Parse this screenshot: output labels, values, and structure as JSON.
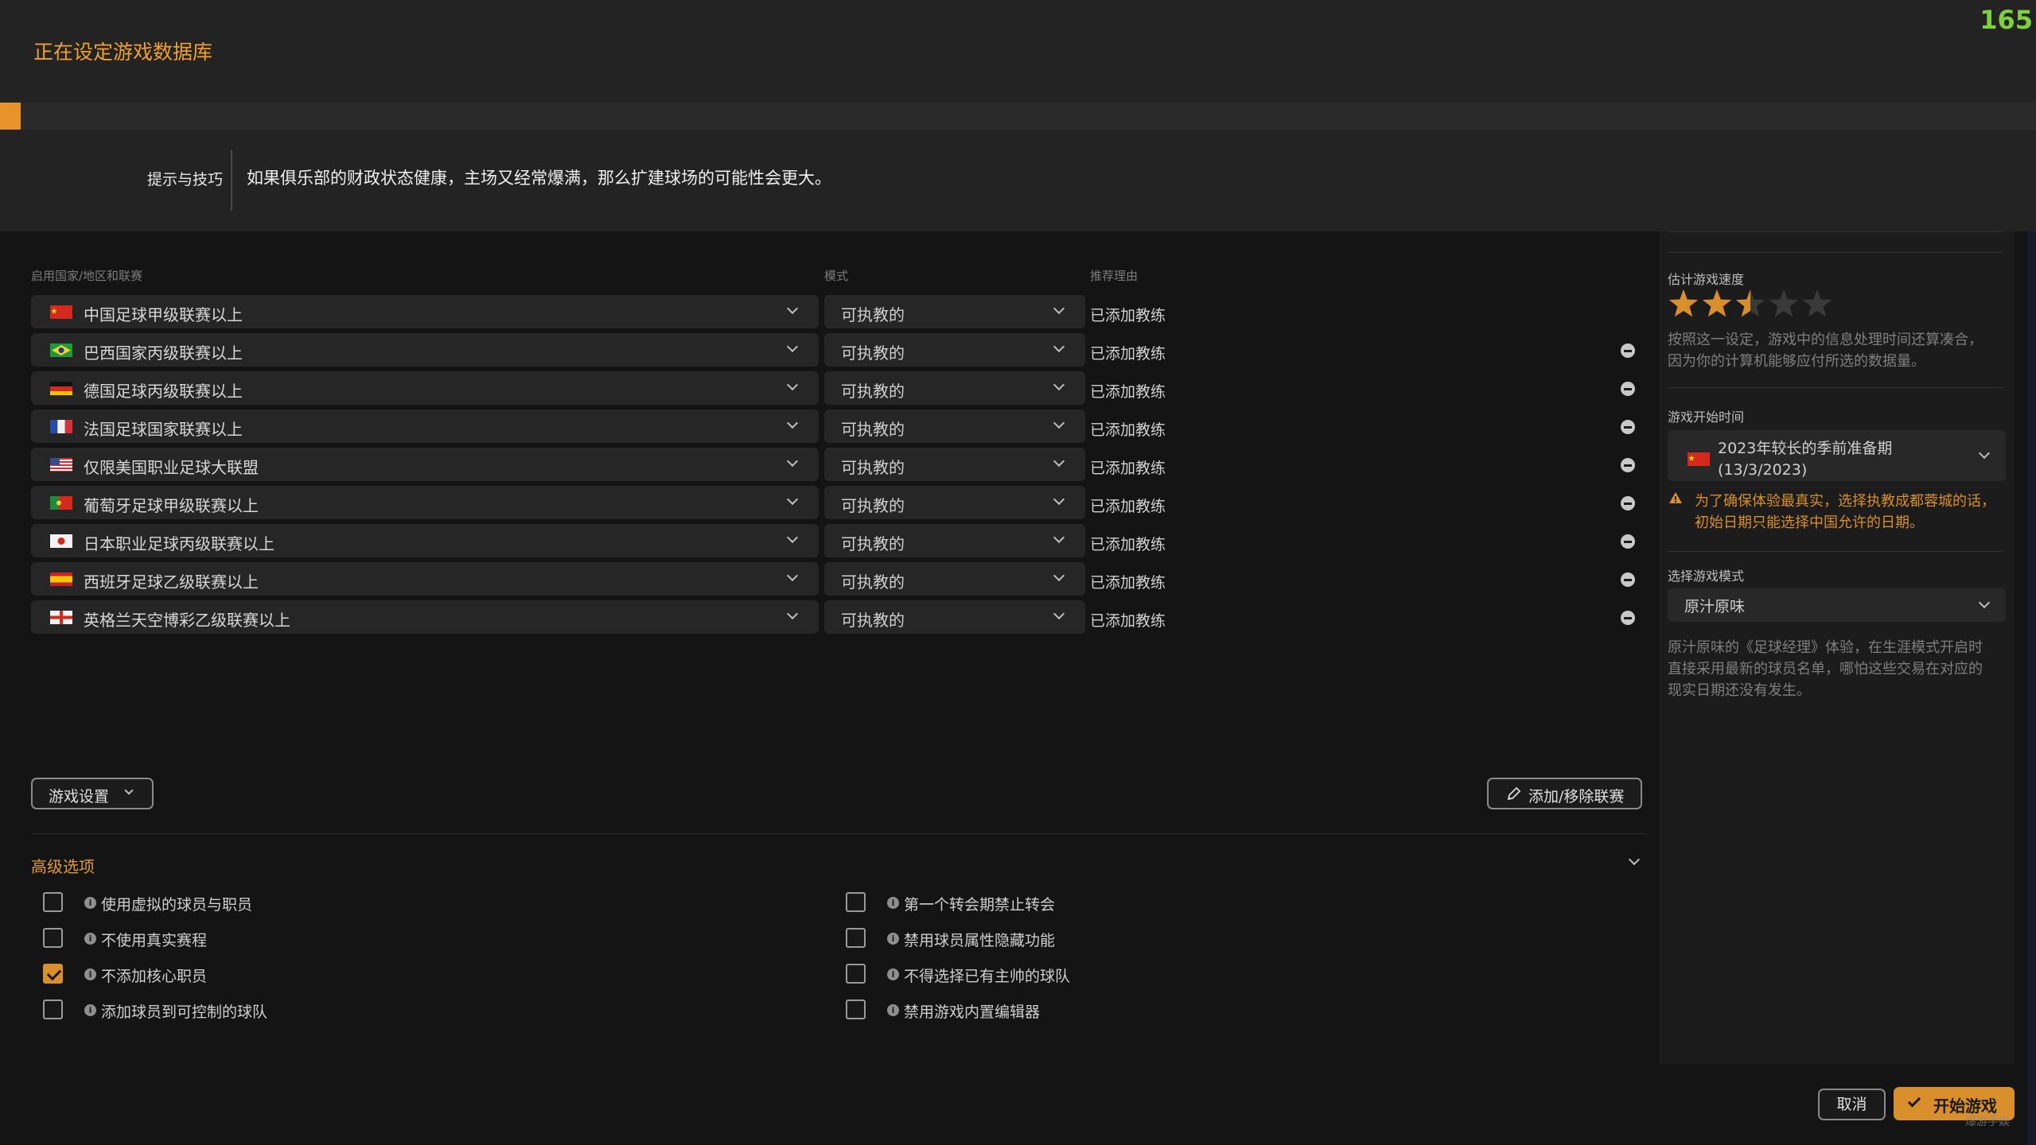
{
  "header": {
    "loading_title": "正在设定游戏数据库",
    "fps": "165",
    "progress": 0.01
  },
  "tips": {
    "label": "提示与技巧",
    "text": "如果俱乐部的财政状态健康，主场又经常爆满，那么扩建球场的可能性会更大。"
  },
  "table": {
    "headers": {
      "league": "启用国家/地区和联赛",
      "mode": "模式",
      "reason": "推荐理由"
    },
    "rows": [
      {
        "flag": "china",
        "league": "中国足球甲级联赛以上",
        "mode": "可执教的",
        "reason": "已添加教练",
        "removable": false
      },
      {
        "flag": "brazil",
        "league": "巴西国家丙级联赛以上",
        "mode": "可执教的",
        "reason": "已添加教练",
        "removable": true
      },
      {
        "flag": "germany",
        "league": "德国足球丙级联赛以上",
        "mode": "可执教的",
        "reason": "已添加教练",
        "removable": true
      },
      {
        "flag": "france",
        "league": "法国足球国家联赛以上",
        "mode": "可执教的",
        "reason": "已添加教练",
        "removable": true
      },
      {
        "flag": "usa",
        "league": "仅限美国职业足球大联盟",
        "mode": "可执教的",
        "reason": "已添加教练",
        "removable": true
      },
      {
        "flag": "portugal",
        "league": "葡萄牙足球甲级联赛以上",
        "mode": "可执教的",
        "reason": "已添加教练",
        "removable": true
      },
      {
        "flag": "japan",
        "league": "日本职业足球丙级联赛以上",
        "mode": "可执教的",
        "reason": "已添加教练",
        "removable": true
      },
      {
        "flag": "spain",
        "league": "西班牙足球乙级联赛以上",
        "mode": "可执教的",
        "reason": "已添加教练",
        "removable": true
      },
      {
        "flag": "england",
        "league": "英格兰天空博彩乙级联赛以上",
        "mode": "可执教的",
        "reason": "已添加教练",
        "removable": true
      }
    ]
  },
  "buttons": {
    "game_settings": "游戏设置",
    "add_remove_league": "添加/移除联赛",
    "cancel": "取消",
    "start_game": "开始游戏"
  },
  "advanced": {
    "title": "高级选项",
    "left_options": [
      {
        "label": "使用虚拟的球员与职员",
        "checked": false
      },
      {
        "label": "不使用真实赛程",
        "checked": false
      },
      {
        "label": "不添加核心职员",
        "checked": true
      },
      {
        "label": "添加球员到可控制的球队",
        "checked": false
      }
    ],
    "right_options": [
      {
        "label": "第一个转会期禁止转会",
        "checked": false
      },
      {
        "label": "禁用球员属性隐藏功能",
        "checked": false
      },
      {
        "label": "不得选择已有主帅的球队",
        "checked": false
      },
      {
        "label": "禁用游戏内置编辑器",
        "checked": false
      }
    ]
  },
  "right_panel": {
    "speed_label": "估计游戏速度",
    "speed_rating": 2.5,
    "speed_max": 5,
    "speed_desc": "按照这一设定，游戏中的信息处理时间还算凑合，因为你的计算机能够应付所选的数据量。",
    "start_label": "游戏开始时间",
    "start_value_line1": "2023年较长的季前准备期",
    "start_value_line2": "(13/3/2023)",
    "start_warning": "为了确保体验最真实，选择执教成都蓉城的话，初始日期只能选择中国允许的日期。",
    "mode_label": "选择游戏模式",
    "mode_value": "原汁原味",
    "mode_desc": "原汁原味的《足球经理》体验，在生涯模式开启时直接采用最新的球员名单，哪怕这些交易在对应的现实日期还没有发生。"
  },
  "watermark": "爆游手娱",
  "colors": {
    "accent": "#d88f2c",
    "fps": "#7fd13a",
    "background": "#141414",
    "panel": "#232323"
  }
}
